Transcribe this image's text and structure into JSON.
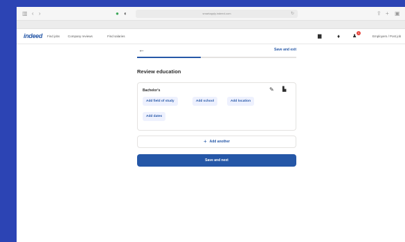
{
  "browser": {
    "url": "smartapply.indeed.com",
    "icons": {
      "sidebar": "sidebar-icon",
      "back": "back-icon",
      "forward": "forward-icon",
      "privacy": "privacy-icon",
      "shield": "shield-icon",
      "reload": "reload-icon",
      "share": "share-icon",
      "new_tab": "new-tab-icon",
      "tabs": "tabs-icon"
    }
  },
  "site": {
    "logo": "indeed",
    "nav": [
      "Find jobs",
      "Company reviews",
      "Find salaries"
    ],
    "notification_count": "1",
    "employers": "Employers / Post job"
  },
  "form": {
    "save_exit": "Save and exit",
    "progress": 0.4,
    "title": "Review education",
    "entry": {
      "degree": "Bachelor's",
      "chips": [
        "Add field of study",
        "Add school",
        "Add location",
        "Add dates"
      ]
    },
    "add_another": "Add another",
    "primary": "Save and next"
  },
  "colors": {
    "background": "#2c44b4",
    "accent": "#2557a7",
    "chip_bg": "#eef1fe",
    "badge": "#e8453c"
  }
}
